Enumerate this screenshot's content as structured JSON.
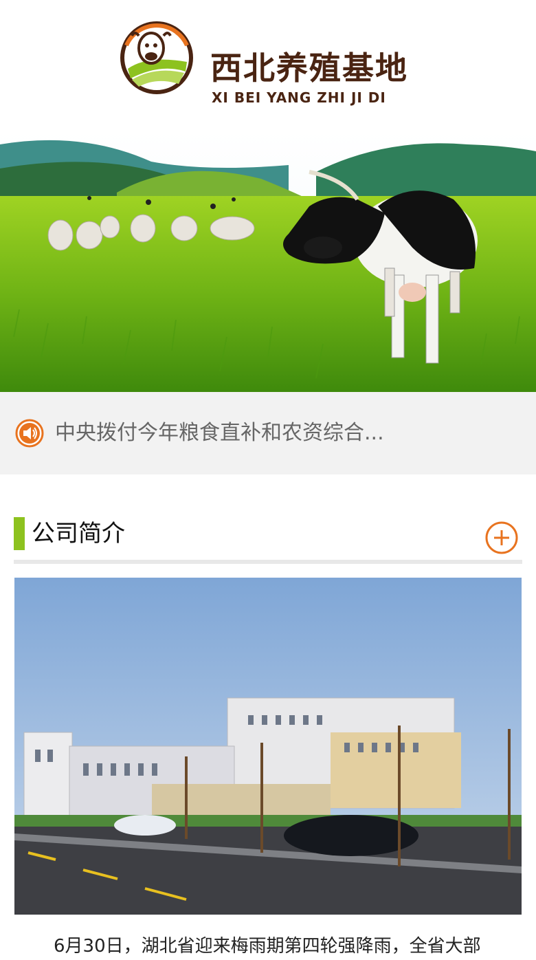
{
  "header": {
    "logo_cn": "西北养殖基地",
    "logo_en": "XI BEI YANG ZHI JI DI"
  },
  "banner": {
    "image": "pasture-with-cow-and-sheep"
  },
  "notice": {
    "icon": "speaker-icon",
    "text": "中央拨付今年粮食直补和农资综合..."
  },
  "about": {
    "title": "公司简介",
    "more_icon": "plus-circle-icon",
    "image": "company-building-photo",
    "intro_text": "6月30日，湖北省迎来梅雨期第四轮强降雨，全省大部"
  },
  "colors": {
    "brand_brown": "#4a2412",
    "accent_orange": "#e8731f",
    "accent_green": "#8dc21f"
  }
}
